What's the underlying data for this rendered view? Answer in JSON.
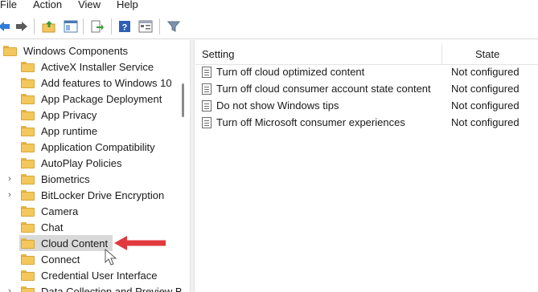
{
  "menubar": {
    "items": [
      "File",
      "Action",
      "View",
      "Help"
    ]
  },
  "toolbar": {
    "buttons": [
      "back-icon",
      "forward-icon",
      "up-folder-icon",
      "show-hide-tree-icon",
      "export-list-icon",
      "help-icon",
      "properties-icon",
      "filter-icon"
    ]
  },
  "tree": {
    "root_label": "Windows Components",
    "items": [
      {
        "label": "ActiveX Installer Service",
        "expandable": false
      },
      {
        "label": "Add features to Windows 10",
        "expandable": false
      },
      {
        "label": "App Package Deployment",
        "expandable": false
      },
      {
        "label": "App Privacy",
        "expandable": false
      },
      {
        "label": "App runtime",
        "expandable": false
      },
      {
        "label": "Application Compatibility",
        "expandable": false
      },
      {
        "label": "AutoPlay Policies",
        "expandable": false
      },
      {
        "label": "Biometrics",
        "expandable": true
      },
      {
        "label": "BitLocker Drive Encryption",
        "expandable": true
      },
      {
        "label": "Camera",
        "expandable": false
      },
      {
        "label": "Chat",
        "expandable": false
      },
      {
        "label": "Cloud Content",
        "expandable": false,
        "selected": true
      },
      {
        "label": "Connect",
        "expandable": false
      },
      {
        "label": "Credential User Interface",
        "expandable": false
      },
      {
        "label": "Data Collection and Preview B",
        "expandable": true
      }
    ]
  },
  "list": {
    "columns": {
      "setting": "Setting",
      "state": "State"
    },
    "rows": [
      {
        "name": "Turn off cloud optimized content",
        "state": "Not configured"
      },
      {
        "name": "Turn off cloud consumer account state content",
        "state": "Not configured"
      },
      {
        "name": "Do not show Windows tips",
        "state": "Not configured"
      },
      {
        "name": "Turn off Microsoft consumer experiences",
        "state": "Not configured"
      }
    ]
  },
  "colors": {
    "selection": "#d9d9d9",
    "folder": "#f4c75c",
    "annotation_arrow": "#e0393e"
  }
}
